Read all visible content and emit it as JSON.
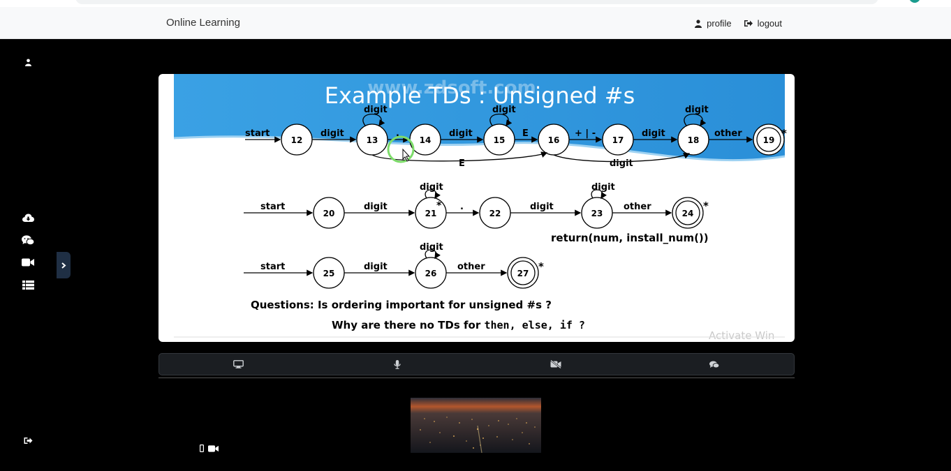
{
  "navbar": {
    "brand": "Online Learning",
    "profile_label": "profile",
    "logout_label": "logout"
  },
  "sidebar": {
    "icons": [
      "user-icon",
      "cloud-download-icon",
      "wechat-icon",
      "video-icon",
      "list-icon",
      "sign-out-icon"
    ],
    "toggle_icon": "chevron-right-icon"
  },
  "slide": {
    "title": "Example TDs : Unsigned #s",
    "watermark": "www.zdsoft.com",
    "row1": {
      "states": [
        "12",
        "13",
        "14",
        "15",
        "16",
        "17",
        "18",
        "19"
      ],
      "labels": {
        "start": "start",
        "digit": "digit",
        "dot": ".",
        "E": "E",
        "plusminus": "+ | -",
        "other": "other",
        "star": "*"
      }
    },
    "row2": {
      "states": [
        "20",
        "21",
        "22",
        "23",
        "24"
      ],
      "return_text": "return(num, install_num())"
    },
    "row3": {
      "states": [
        "25",
        "26",
        "27"
      ]
    },
    "question1": "Questions:  Is ordering important for unsigned #s ?",
    "question2_prefix": "Why are there no TDs for ",
    "question2_code": "then, else, if ?",
    "activate_text": "Activate Win"
  },
  "controls": [
    "monitor-icon",
    "microphone-icon",
    "video-off-icon",
    "chat-icon"
  ],
  "local_controls": [
    "phone-icon",
    "video-icon"
  ],
  "colors": {
    "navbar_bg": "#f8f9fa",
    "page_bg": "#000000",
    "control_bar_bg": "#1b1e22",
    "toggle_bg": "#1f2f44",
    "slide_banner": "#3b9be0"
  }
}
